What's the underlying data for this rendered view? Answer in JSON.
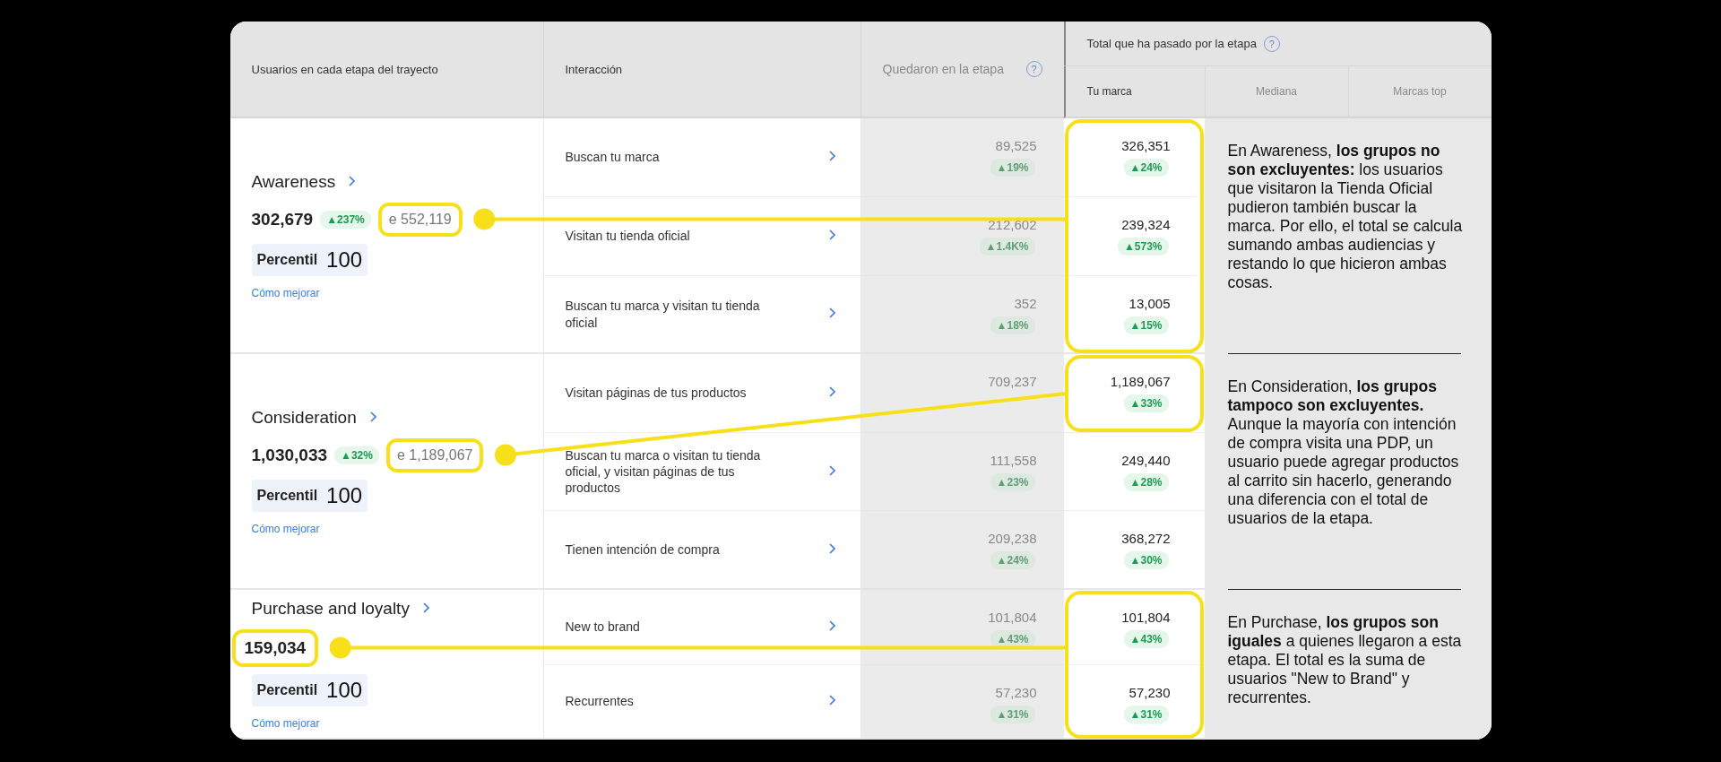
{
  "table": {
    "columns": [
      {
        "label": "Usuarios en cada etapa del trayecto"
      },
      {
        "label": "Interacción"
      },
      {
        "label": "Quedaron en la etapa",
        "help": "?",
        "dimmed": true
      }
    ],
    "group": {
      "label": "Total que ha pasado por la etapa",
      "help": "?",
      "subcolumns": [
        {
          "label": "Tu marca",
          "dimmed": false
        },
        {
          "label": "Mediana",
          "dimmed": true
        },
        {
          "label": "Marcas top",
          "dimmed": true
        }
      ]
    },
    "stages": [
      {
        "name": "Awareness",
        "total": "302,679",
        "change": "▲237%",
        "compared": "e 552,119",
        "compared_highlighted": true,
        "total_highlighted": false,
        "percentile_label": "Percentil",
        "percentile": "100",
        "link": "Cómo mejorar",
        "interactions": [
          {
            "label": "Buscan tu marca",
            "stayed": {
              "value": "89,525",
              "change": "▲19%"
            },
            "total": {
              "value": "326,351",
              "change": "▲24%",
              "highlighted": true
            }
          },
          {
            "label": "Visitan tu tienda oficial",
            "stayed": {
              "value": "212,602",
              "change": "▲1.4K%"
            },
            "total": {
              "value": "239,324",
              "change": "▲573%",
              "highlighted": true
            }
          },
          {
            "label": "Buscan tu marca y visitan tu tienda oficial",
            "stayed": {
              "value": "352",
              "change": "▲18%"
            },
            "total": {
              "value": "13,005",
              "change": "▲15%",
              "highlighted": true
            }
          }
        ]
      },
      {
        "name": "Consideration",
        "total": "1,030,033",
        "change": "▲32%",
        "compared": "e 1,189,067",
        "compared_highlighted": true,
        "total_highlighted": false,
        "percentile_label": "Percentil",
        "percentile": "100",
        "link": "Cómo mejorar",
        "interactions": [
          {
            "label": "Visitan páginas de tus productos",
            "stayed": {
              "value": "709,237"
            },
            "total": {
              "value": "1,189,067",
              "change": "▲33%",
              "highlighted": true
            }
          },
          {
            "label": "Buscan tu marca o visitan tu tienda oficial, y visitan páginas de tus productos",
            "stayed": {
              "value": "111,558",
              "change": "▲23%"
            },
            "total": {
              "value": "249,440",
              "change": "▲28%",
              "highlighted": false
            }
          },
          {
            "label": "Tienen intención de compra",
            "stayed": {
              "value": "209,238",
              "change": "▲24%"
            },
            "total": {
              "value": "368,272",
              "change": "▲30%",
              "highlighted": false
            }
          }
        ]
      },
      {
        "name": "Purchase and loyalty",
        "total": "159,034",
        "total_highlighted": true,
        "percentile_label": "Percentil",
        "percentile": "100",
        "link": "Cómo mejorar",
        "interactions": [
          {
            "label": "New to brand",
            "stayed": {
              "value": "101,804",
              "change": "▲43%"
            },
            "total": {
              "value": "101,804",
              "change": "▲43%",
              "highlighted": true
            }
          },
          {
            "label": "Recurrentes",
            "stayed": {
              "value": "57,230",
              "change": "▲31%"
            },
            "total": {
              "value": "57,230",
              "change": "▲31%",
              "highlighted": true
            }
          }
        ]
      }
    ]
  },
  "annotations": [
    {
      "text": "En Awareness, **los grupos no son excluyentes:** los usuarios que visitaron la Tienda Oficial pudieron también buscar la marca. Por ello, el total se calcula sumando ambas audiencias y restando lo que hicieron ambas cosas."
    },
    {
      "text": "En Consideration, **los grupos tampoco son excluyentes.** Aunque la mayoría con intención de compra visita una PDP, un usuario puede agregar productos al carrito sin hacerlo, generando una diferencia con el total de usuarios de la etapa."
    },
    {
      "text": "En Purchase, **los grupos son iguales** a quienes llegaron a esta etapa. El total es la suma de usuarios \"New to Brand\" y recurrentes."
    }
  ]
}
